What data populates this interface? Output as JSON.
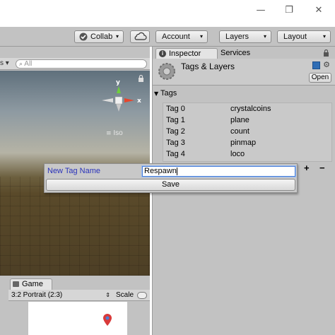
{
  "window": {
    "minimize_glyph": "—",
    "maximize_glyph": "❐",
    "close_glyph": "✕"
  },
  "toolbar": {
    "collab_label": "Collab",
    "account_label": "Account",
    "layers_label": "Layers",
    "layout_label": "Layout",
    "dropdown_glyph": "▾"
  },
  "scene": {
    "search_placeholder": "All",
    "gizmo_y": "y",
    "gizmo_x": "x",
    "iso_label": "Iso"
  },
  "game": {
    "tab_label": "Game",
    "aspect_label": "3:2 Portrait (2:3)",
    "scale_label": "Scale"
  },
  "inspector": {
    "tab_inspector": "Inspector",
    "tab_services": "Services",
    "title": "Tags & Layers",
    "open_button": "Open",
    "tags_heading": "Tags",
    "tags": [
      {
        "key": "Tag 0",
        "value": "crystalcoins"
      },
      {
        "key": "Tag 1",
        "value": "plane"
      },
      {
        "key": "Tag 2",
        "value": "count"
      },
      {
        "key": "Tag 3",
        "value": "pinmap"
      },
      {
        "key": "Tag 4",
        "value": "loco"
      }
    ],
    "add_glyph": "+",
    "remove_glyph": "−"
  },
  "popup": {
    "label": "New Tag Name",
    "input_value": "Respawn",
    "save_label": "Save"
  },
  "colors": {
    "label_blue": "#2a33bb",
    "focus_blue": "#4a7fd6",
    "gizmo_red": "#e8452c",
    "gizmo_green": "#6fcf3b"
  }
}
